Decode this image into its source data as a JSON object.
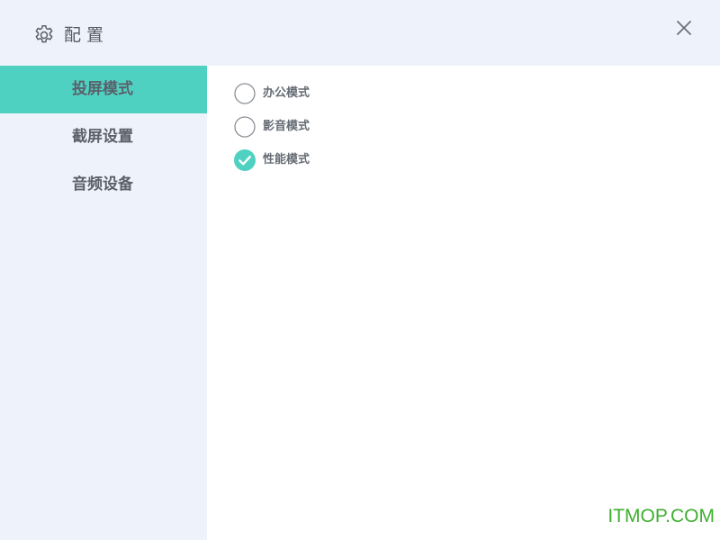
{
  "window": {
    "title": "配置",
    "icon": "gear-icon",
    "close_icon": "close-icon"
  },
  "sidebar": {
    "items": [
      {
        "label": "投屏模式",
        "active": true
      },
      {
        "label": "截屏设置",
        "active": false
      },
      {
        "label": "音频设备",
        "active": false
      }
    ]
  },
  "modes": {
    "options": [
      {
        "label": "办公模式",
        "checked": false
      },
      {
        "label": "影音模式",
        "checked": false
      },
      {
        "label": "性能模式",
        "checked": true
      }
    ]
  },
  "watermark": "ITMOP.COM",
  "colors": {
    "accent": "#4fd1c1",
    "panel_bg": "#eef2fa",
    "text": "#5a616b",
    "watermark": "#3fae2f"
  }
}
